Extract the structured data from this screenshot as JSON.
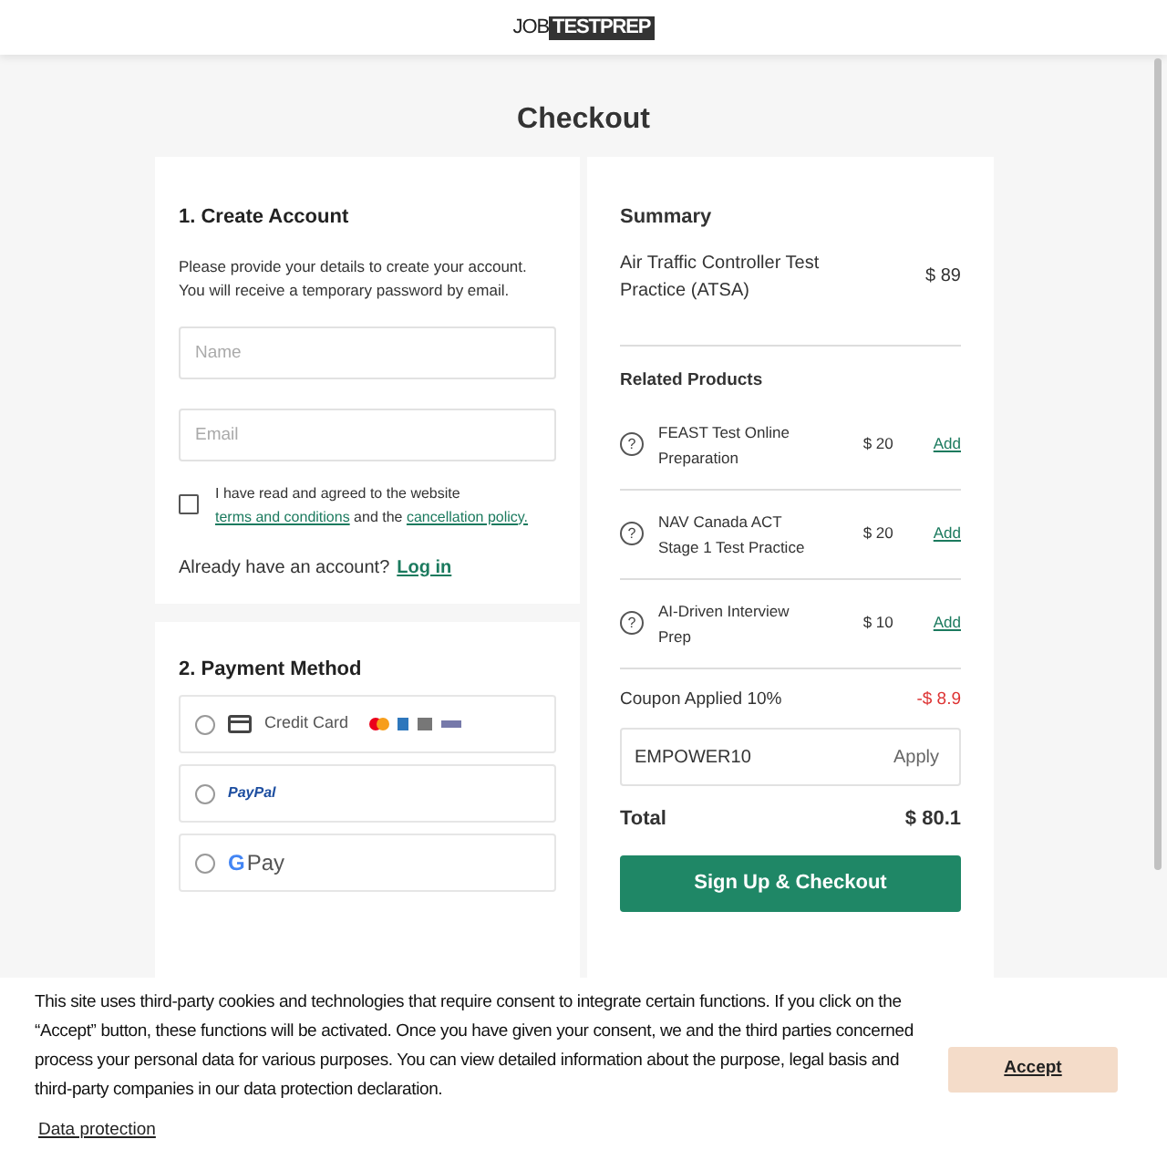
{
  "header": {
    "logo_left": "JOB",
    "logo_right": "TESTPREP"
  },
  "page_title": "Checkout",
  "create_account": {
    "heading": "1. Create Account",
    "intro": "Please provide your details to create your account. You will receive a temporary password by email.",
    "fields": [
      {
        "placeholder": "Name"
      },
      {
        "placeholder": "Email"
      }
    ],
    "terms": {
      "checked": false,
      "text_before": "I have read and agreed to the website",
      "link_1": "terms and conditions",
      "text_middle": "and the",
      "link_2": "cancellation policy."
    },
    "login_prompt": "Already have an account?",
    "login_link": "Log in"
  },
  "payment": {
    "heading": "2. Payment Method",
    "options": [
      {
        "kind": "card",
        "label": "Credit Card",
        "selected": false
      },
      {
        "kind": "paypal",
        "label": "PayPal",
        "selected": false
      },
      {
        "kind": "gpay",
        "logo_letter": "G",
        "label": "Pay",
        "selected": false
      }
    ]
  },
  "summary": {
    "heading": "Summary",
    "product": {
      "name": "Air Traffic Controller Test Practice (ATSA)",
      "price": "$ 89"
    },
    "related_heading": "Related Products",
    "related": [
      {
        "help_icon": "?",
        "name": "FEAST Test Online Preparation",
        "price": "$ 20",
        "action": "Add"
      },
      {
        "help_icon": "?",
        "name": "NAV Canada ACT Stage 1 Test Practice",
        "price": "$ 20",
        "action": "Add"
      },
      {
        "help_icon": "?",
        "name": "AI-Driven Interview Prep",
        "price": "$ 10",
        "action": "Add"
      }
    ],
    "coupon_label": "Coupon Applied 10%",
    "coupon_amount": "-$ 8.9",
    "coupon_code": "EMPOWER10",
    "apply_button": "Apply",
    "total_label": "Total",
    "total_value": "$ 80.1",
    "checkout_button": "Sign Up & Checkout"
  },
  "cookie_banner": {
    "text": "This site uses third-party cookies and technologies that require consent to integrate certain functions. If you click on the “Accept” button, these functions will be activated. Once you have given your consent, we and the third parties concerned process your personal data for various purposes. You can view detailed information about the purpose, legal basis and third-party companies in our data protection declaration.",
    "link": "Data protection",
    "button": "Accept"
  }
}
